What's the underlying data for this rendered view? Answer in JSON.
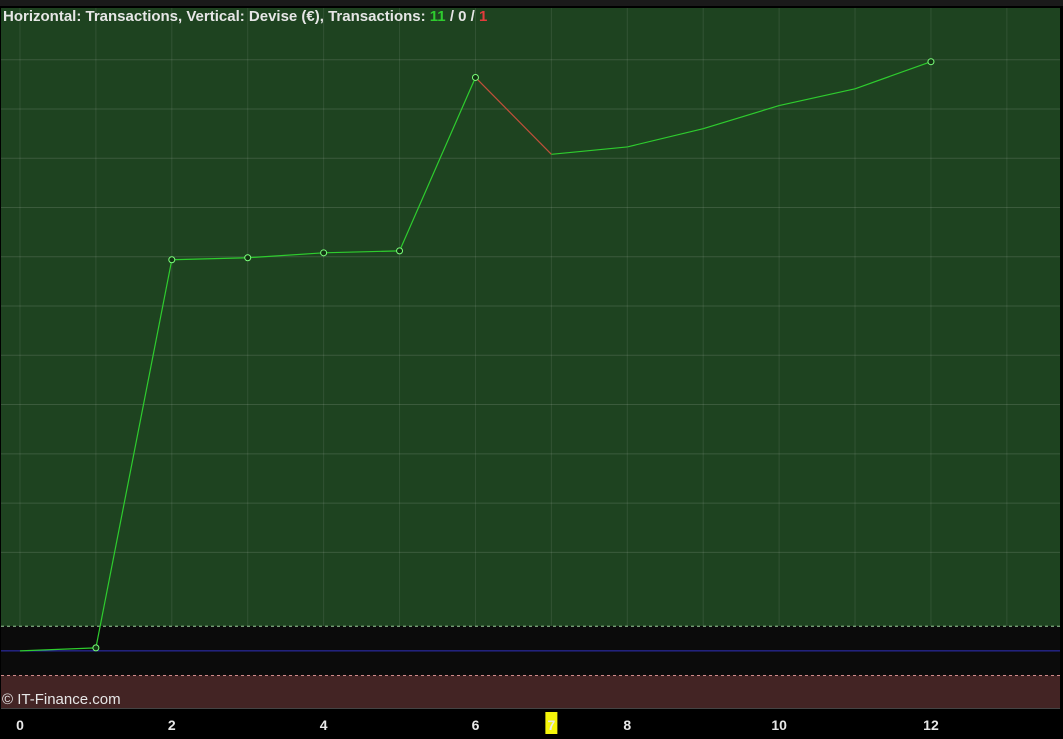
{
  "header": {
    "prefix": "Horizontal: Transactions, Vertical: Devise (€), Transactions: ",
    "wins": "11",
    "sep1": " / ",
    "neutral": "0",
    "sep2": " / ",
    "losses": "1"
  },
  "footer": {
    "copyright": "© IT-Finance.com"
  },
  "colors": {
    "profit_zone": "#1e4320",
    "loss_zone": "#432424",
    "neutral_band": "#0b0b0b",
    "line_up": "#2ecc2e",
    "line_down": "#c0503a",
    "baseline": "#3030c0",
    "highlight": "#f5f50a"
  },
  "chart_data": {
    "type": "line",
    "x": [
      0,
      1,
      2,
      3,
      4,
      5,
      6,
      7,
      8,
      9,
      10,
      11,
      12
    ],
    "values": [
      0,
      0.6,
      79.4,
      79.8,
      80.8,
      81.2,
      116.4,
      100.8,
      102.3,
      106.0,
      110.7,
      114.1,
      119.6
    ],
    "markers_at": [
      1,
      2,
      3,
      4,
      5,
      6,
      12
    ],
    "highlighted_x": 7,
    "x_tick_labels": [
      "0",
      "2",
      "4",
      "6",
      "7",
      "8",
      "10",
      "12"
    ],
    "xlim": [
      -0.25,
      13.7
    ],
    "ylim": [
      -11.6,
      130.5
    ],
    "title": "Horizontal: Transactions, Vertical: Devise (€), Transactions: 11 / 0 / 1",
    "grid": true
  }
}
